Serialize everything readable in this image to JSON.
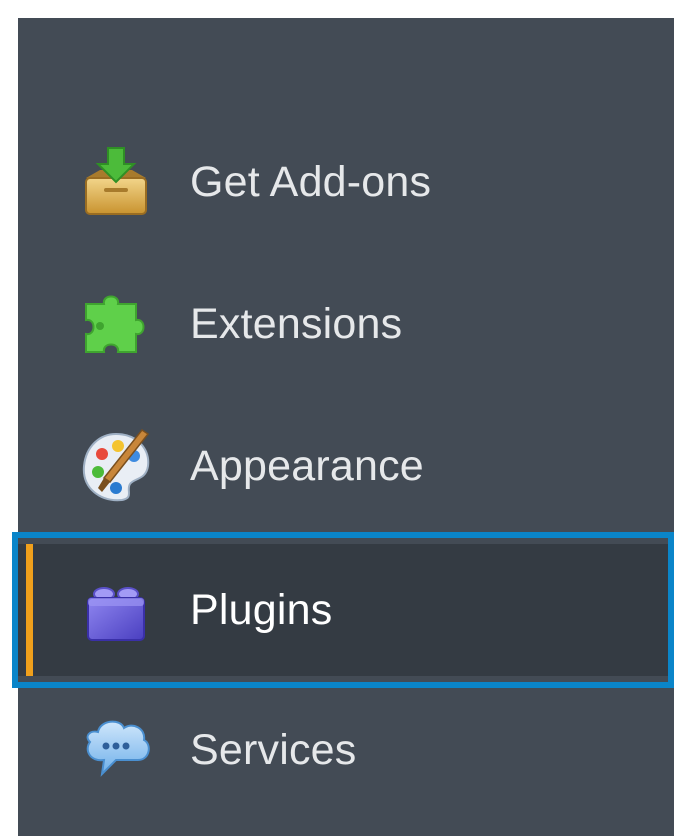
{
  "sidebar": {
    "items": [
      {
        "label": "Get Add-ons",
        "icon": "get-addons-icon",
        "selected": false
      },
      {
        "label": "Extensions",
        "icon": "extensions-puzzle-icon",
        "selected": false
      },
      {
        "label": "Appearance",
        "icon": "appearance-palette-icon",
        "selected": false
      },
      {
        "label": "Plugins",
        "icon": "plugins-brick-icon",
        "selected": true
      },
      {
        "label": "Services",
        "icon": "services-chat-icon",
        "selected": false
      }
    ]
  },
  "colors": {
    "sidebar_background": "#434b55",
    "selected_background": "#343b43",
    "selected_accent": "#f0a01c",
    "highlight_frame": "#0a85c9",
    "label_text": "#e6e8ea"
  }
}
